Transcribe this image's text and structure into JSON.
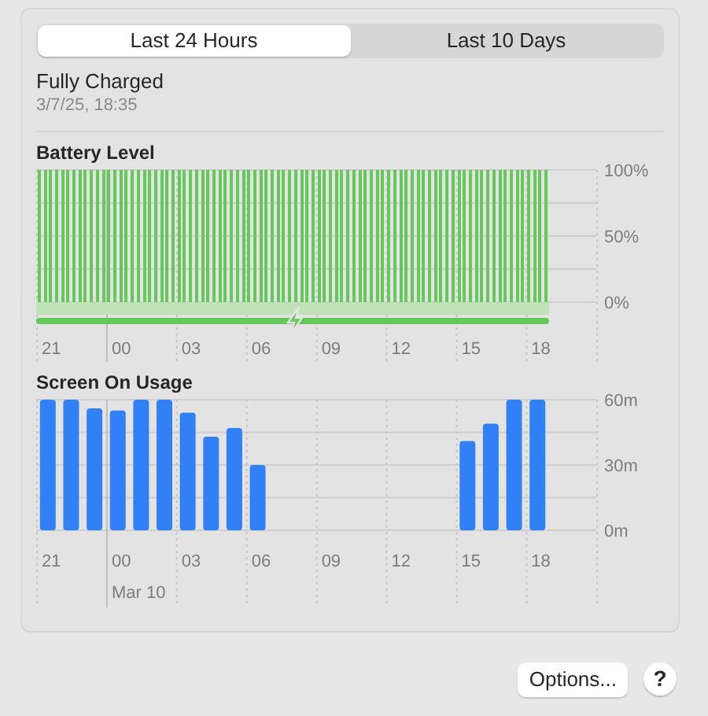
{
  "tabs": [
    {
      "label": "Last 24 Hours",
      "selected": true
    },
    {
      "label": "Last 10 Days",
      "selected": false
    }
  ],
  "status": {
    "title": "Fully Charged",
    "time": "3/7/25, 18:35"
  },
  "battery_level": {
    "charging": true,
    "chart_data": {
      "type": "bar",
      "title": "Battery Level",
      "ylim": [
        0,
        100
      ],
      "yticks": [
        {
          "value": 0,
          "label": "0%"
        },
        {
          "value": 50,
          "label": "50%"
        },
        {
          "value": 100,
          "label": "100%"
        }
      ],
      "categories": [
        null,
        null,
        "21",
        null,
        null,
        null,
        null,
        null,
        null,
        null,
        null,
        null,
        null,
        null,
        "00",
        null,
        null,
        null,
        null,
        null,
        null,
        null,
        null,
        null,
        null,
        null,
        "03",
        null,
        null,
        null,
        null,
        null,
        null,
        null,
        null,
        null,
        null,
        null,
        "06",
        null,
        null,
        null,
        null,
        null,
        null,
        null,
        null,
        null,
        null,
        null,
        "09",
        null,
        null,
        null,
        null,
        null,
        null,
        null,
        null,
        null,
        null,
        null,
        "12",
        null,
        null,
        null,
        null,
        null,
        null,
        null,
        null,
        null,
        null,
        null,
        "15",
        null,
        null,
        null,
        null,
        null,
        null,
        null,
        null,
        null,
        null,
        null,
        "18",
        null
      ],
      "series": [
        {
          "color": "#65c85a",
          "values": [
            100,
            100,
            100,
            100,
            100,
            100,
            100,
            100,
            100,
            100,
            100,
            100,
            100,
            100,
            100,
            100,
            100,
            100,
            100,
            100,
            100,
            100,
            100,
            100,
            100,
            100,
            100,
            100,
            100,
            100,
            100,
            100,
            100,
            100,
            100,
            100,
            100,
            100,
            100,
            100,
            100,
            100,
            100,
            100,
            100,
            100,
            100,
            100,
            100,
            100,
            100,
            100,
            100,
            100,
            100,
            100,
            100,
            100,
            100,
            100,
            100,
            100,
            100,
            100,
            100,
            100,
            100,
            100,
            100,
            100,
            100,
            100,
            100,
            100,
            100,
            100,
            100,
            100,
            100,
            100,
            100,
            100,
            100,
            100,
            100,
            100,
            100,
            100
          ]
        }
      ]
    }
  },
  "screen_usage": {
    "date_label": "Mar 10",
    "chart_data": {
      "type": "bar",
      "title": "Screen On Usage",
      "ylim": [
        0,
        60
      ],
      "yticks": [
        {
          "value": 0,
          "label": "0m"
        },
        {
          "value": 30,
          "label": "30m"
        },
        {
          "value": 60,
          "label": "60m"
        }
      ],
      "categories": [
        "21",
        null,
        null,
        "00",
        null,
        null,
        "03",
        null,
        null,
        "06",
        null,
        null,
        "09",
        null,
        null,
        "12",
        null,
        null,
        "15",
        null,
        null,
        "18"
      ],
      "series": [
        {
          "color": "#3180f6",
          "values": [
            60,
            60,
            56,
            55,
            60,
            60,
            54,
            43,
            47,
            30,
            null,
            null,
            null,
            null,
            null,
            null,
            null,
            null,
            41,
            49,
            60,
            60
          ]
        }
      ]
    }
  },
  "buttons": {
    "options": "Options...",
    "help": "?"
  }
}
